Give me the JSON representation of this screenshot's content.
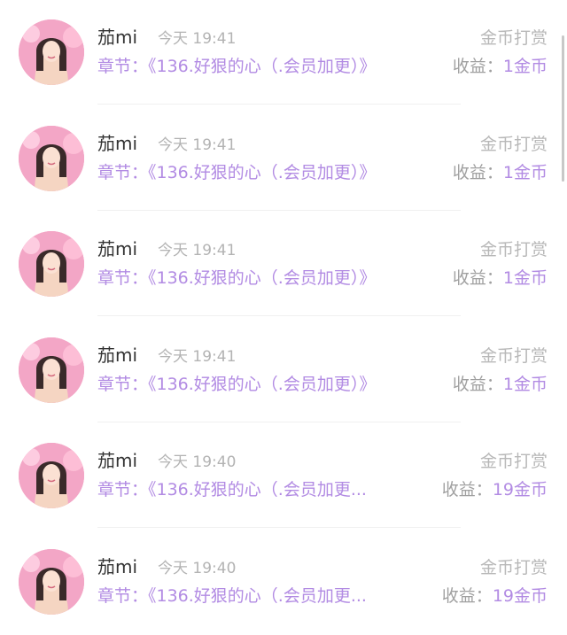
{
  "rows": [
    {
      "name": "茄mi",
      "time": "今天 19:41",
      "type": "金币打赏",
      "chapter": "章节：《136.好狠的心（.会员加更）》",
      "income_label": "收益：",
      "income_amount": "1金币"
    },
    {
      "name": "茄mi",
      "time": "今天 19:41",
      "type": "金币打赏",
      "chapter": "章节：《136.好狠的心（.会员加更）》",
      "income_label": "收益：",
      "income_amount": "1金币"
    },
    {
      "name": "茄mi",
      "time": "今天 19:41",
      "type": "金币打赏",
      "chapter": "章节：《136.好狠的心（.会员加更）》",
      "income_label": "收益：",
      "income_amount": "1金币"
    },
    {
      "name": "茄mi",
      "time": "今天 19:41",
      "type": "金币打赏",
      "chapter": "章节：《136.好狠的心（.会员加更）》",
      "income_label": "收益：",
      "income_amount": "1金币"
    },
    {
      "name": "茄mi",
      "time": "今天 19:40",
      "type": "金币打赏",
      "chapter": "章节：《136.好狠的心（.会员加更...",
      "income_label": "收益：",
      "income_amount": "19金币"
    },
    {
      "name": "茄mi",
      "time": "今天 19:40",
      "type": "金币打赏",
      "chapter": "章节：《136.好狠的心（.会员加更...",
      "income_label": "收益：",
      "income_amount": "19金币"
    }
  ],
  "icons": {
    "avatar": "user-avatar-photo"
  },
  "colors": {
    "accent": "#b28be3",
    "muted": "#b3b3b3",
    "name": "#333333"
  }
}
